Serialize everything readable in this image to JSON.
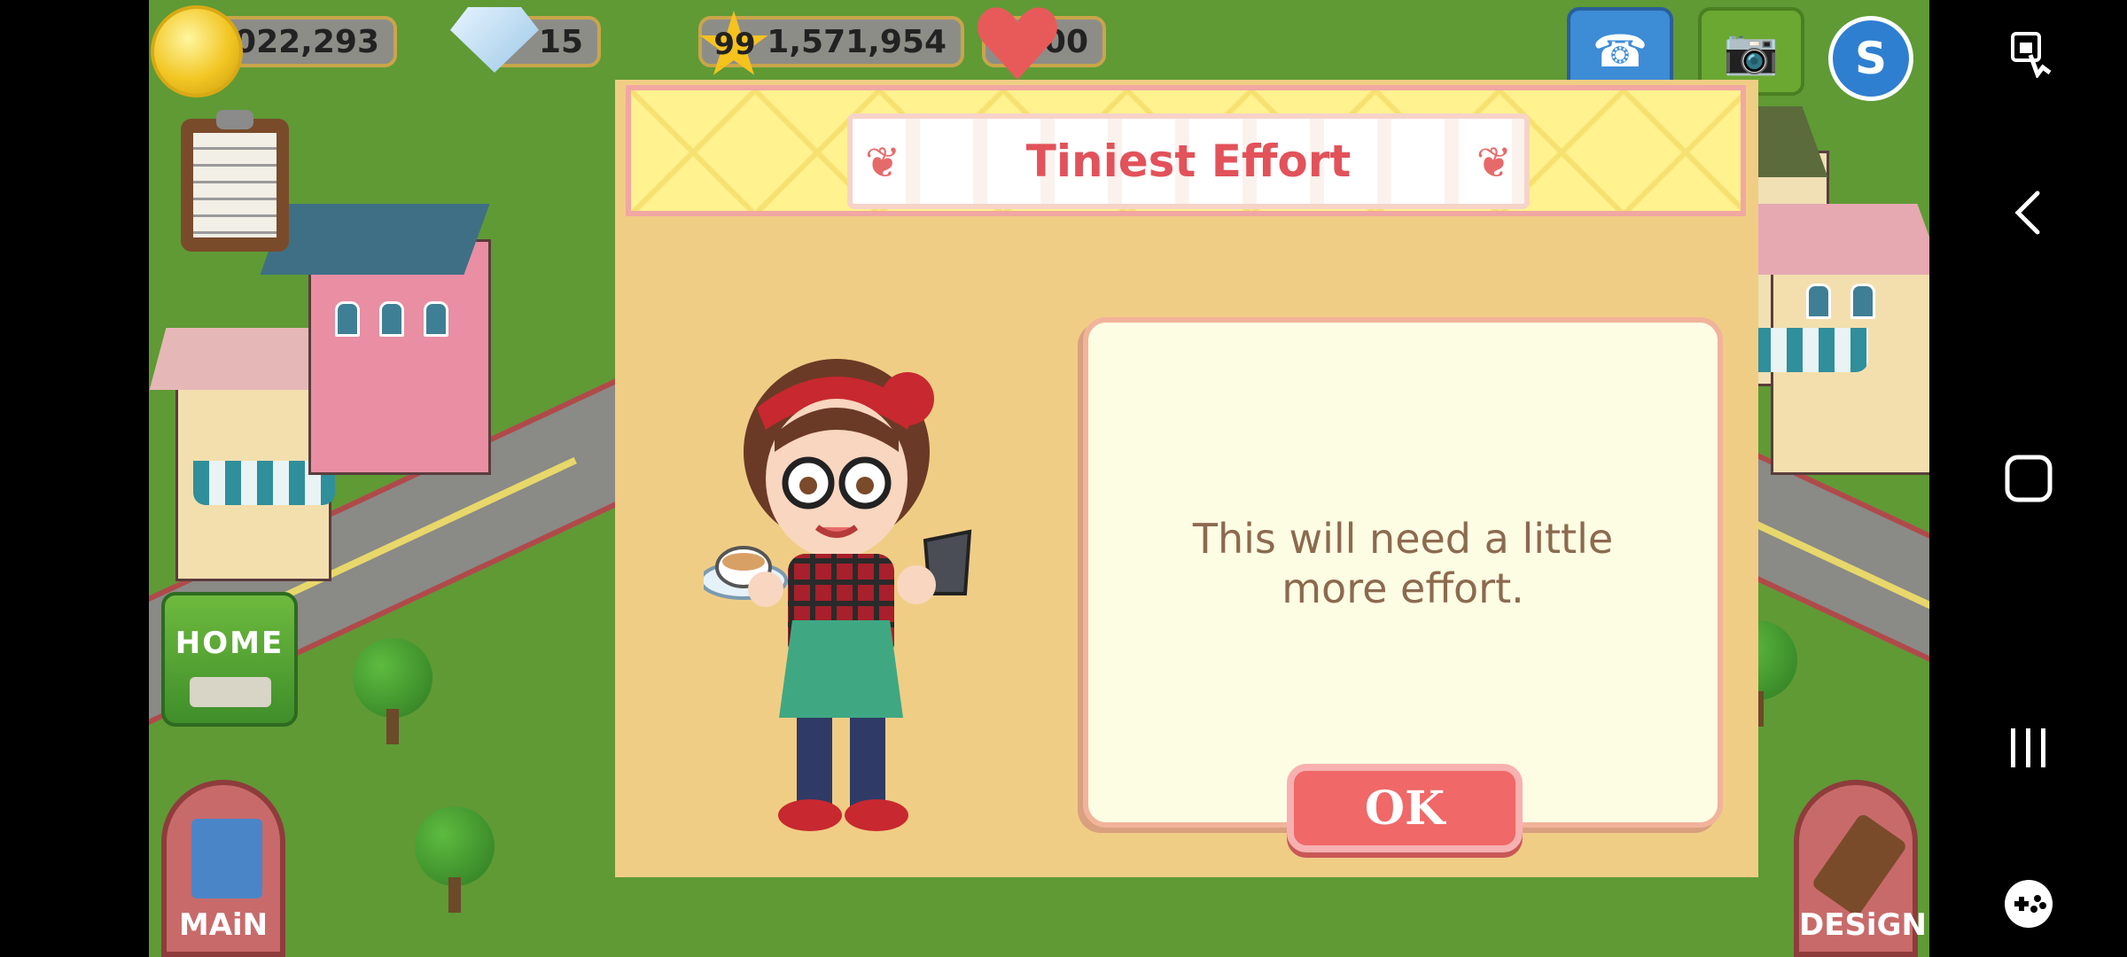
{
  "hud": {
    "coins": "21,022,293",
    "gems": "15",
    "level": "99",
    "xp": "1,571,954",
    "hearts": "100"
  },
  "side_buttons": {
    "home_label": "HOME",
    "main_label": "MAiN",
    "design_label": "DESiGN"
  },
  "dialog": {
    "title": "Tiniest Effort",
    "message": "This will need a little more effort.",
    "ok_label": "OK"
  },
  "colors": {
    "dialog_bg": "#f0cd85",
    "title": "#e2525a",
    "ok_button": "#f06868",
    "message_text": "#8c6a4f"
  }
}
